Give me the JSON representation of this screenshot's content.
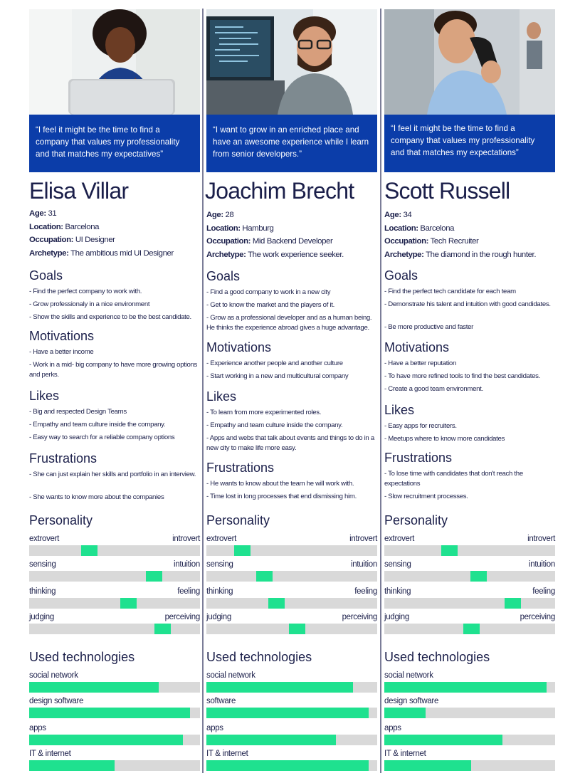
{
  "colors": {
    "quote_bg": "#0b3da9",
    "accent": "#1fe18f",
    "track": "#d9d9d9",
    "text": "#1b1f4a"
  },
  "personas": [
    {
      "photo": "woman-at-laptop-photo",
      "quote": "“I feel it might be the time to find a company that values my professionality and that matches my expectatives”",
      "name": "Elisa Villar",
      "info": [
        {
          "label": "Age:",
          "value": " 31"
        },
        {
          "label": "Location:",
          "value": " Barcelona"
        },
        {
          "label": "Occupation:",
          "value": " UI Designer"
        },
        {
          "label": "Archetype:",
          "value": " The ambitious  mid UI Designer"
        }
      ],
      "sections": [
        {
          "title": "Goals",
          "items": [
            "- Find the perfect company to work with.",
            "- Grow professionaly in a nice environment",
            "- Show the skills and experience to be the best candidate."
          ]
        },
        {
          "title": "Motivations",
          "items": [
            "- Have a better income",
            "- Work in a mid- big company to have more growing options and perks."
          ]
        },
        {
          "title": "Likes",
          "items": [
            " - Big and respected Design Teams",
            " - Empathy and team culture inside the  company.",
            " - Easy way to search for a reliable company options"
          ]
        },
        {
          "title": "Frustrations",
          "items": [
            " - She can just explain her skills and portfolio in an interview.",
            " - She wants to know more about the companies"
          ]
        }
      ],
      "personality": [
        {
          "left": "extrovert",
          "right": "introvert",
          "level": 0.35
        },
        {
          "left": "sensing",
          "right": "intuition",
          "level": 0.73
        },
        {
          "left": "thinking",
          "right": "feeling",
          "level": 0.58
        },
        {
          "left": "judging",
          "right": "perceiving",
          "level": 0.78
        }
      ],
      "technologies": [
        {
          "label": "social network",
          "level": 0.76
        },
        {
          "label": "design software",
          "level": 0.94
        },
        {
          "label": "apps",
          "level": 0.9
        },
        {
          "label": "IT & internet",
          "level": 0.5
        }
      ]
    },
    {
      "photo": "man-with-glasses-at-computer-photo",
      "quote": "“I want to grow in an enriched place and have an awesome experience while I learn from senior developers.”",
      "name": "Joachim Brecht",
      "info": [
        {
          "label": "Age:",
          "value": " 28"
        },
        {
          "label": "Location:",
          "value": " Hamburg"
        },
        {
          "label": "Occupation:",
          "value": " Mid Backend Developer"
        },
        {
          "label": "Archetype:",
          "value": " The work experience seeker."
        }
      ],
      "sections": [
        {
          "title": "Goals",
          "items": [
            "- Find a good company to work in a new  city",
            "- Get to know the market and the players of it.",
            "- Grow as a professional developer and as a human being. He thinks the experience abroad gives a huge advantage."
          ]
        },
        {
          "title": "Motivations",
          "items": [
            " - Experience another people and another culture",
            " - Start working in a new and multicultural company"
          ]
        },
        {
          "title": "Likes",
          "items": [
            "- To learn from more experimented roles.",
            "- Empathy and team culture inside the  company.",
            "- Apps and webs that talk about events and things to do in a new city to make life more easy."
          ]
        },
        {
          "title": "Frustrations",
          "items": [
            " - He wants to know about the team he will work with.",
            " - Time lost in long processes that end dismissing him."
          ]
        }
      ],
      "personality": [
        {
          "left": "extrovert",
          "right": "introvert",
          "level": 0.21
        },
        {
          "left": "sensing",
          "right": "intuition",
          "level": 0.34
        },
        {
          "left": "thinking",
          "right": "feeling",
          "level": 0.41
        },
        {
          "left": "judging",
          "right": "perceiving",
          "level": 0.53
        }
      ],
      "technologies": [
        {
          "label": "social network",
          "level": 0.86
        },
        {
          "label": "software",
          "level": 0.95
        },
        {
          "label": "apps",
          "level": 0.76
        },
        {
          "label": "IT & internet",
          "level": 0.95
        }
      ]
    },
    {
      "photo": "man-on-phone-photo",
      "quote": "“I feel it might be the time to find a company that values my professionality and that matches my expectations”",
      "name": "Scott Russell",
      "info": [
        {
          "label": "Age:",
          "value": " 34"
        },
        {
          "label": "Location:",
          "value": " Barcelona"
        },
        {
          "label": "Occupation:",
          "value": " Tech Recruiter"
        },
        {
          "label": "Archetype:",
          "value": " The diamond in the rough hunter."
        }
      ],
      "sections": [
        {
          "title": "Goals",
          "items": [
            "- Find the perfect tech candidate for each team",
            "- Demonstrate his talent and intuition with good candidates.",
            "- Be more productive and faster"
          ]
        },
        {
          "title": "Motivations",
          "items": [
            "- Have a better reputation",
            "- To have more refined tools to find the best candidates.",
            "- Create a good team environment."
          ]
        },
        {
          "title": "Likes",
          "items": [
            "- Easy apps for recruiters.",
            "- Meetups where to know more candidates"
          ]
        },
        {
          "title": "Frustrations",
          "items": [
            " - To lose time with candidates that don't reach the expectations",
            " - Slow recruitment processes."
          ]
        }
      ],
      "personality": [
        {
          "left": "extrovert",
          "right": "introvert",
          "level": 0.38
        },
        {
          "left": "sensing",
          "right": "intuition",
          "level": 0.55
        },
        {
          "left": "thinking",
          "right": "feeling",
          "level": 0.75
        },
        {
          "left": "judging",
          "right": "perceiving",
          "level": 0.51
        }
      ],
      "technologies": [
        {
          "label": "social network",
          "level": 0.95
        },
        {
          "label": "design software",
          "level": 0.24
        },
        {
          "label": "apps",
          "level": 0.69
        },
        {
          "label": "IT & internet",
          "level": 0.51
        }
      ],
      "personality_title": "Personality",
      "technologies_title": "Used technologies"
    }
  ],
  "labels": {
    "personality": "Personality",
    "technologies": "Used technologies"
  }
}
